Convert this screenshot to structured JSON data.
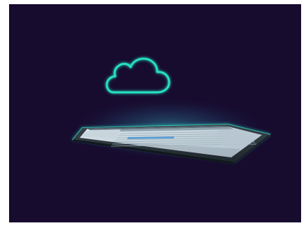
{
  "scene": {
    "background_color": "#170b2e",
    "frame_color": "#ffffff",
    "cloud_icon": {
      "name": "cloud-icon",
      "stroke_color": "#27e0c2",
      "glow_color": "#1fd6c6"
    },
    "device": {
      "name": "tablet-device",
      "edge_glow_color": "#36e3c8",
      "body_color": "#2a3238",
      "screen_content": "desktop-application-window"
    }
  }
}
